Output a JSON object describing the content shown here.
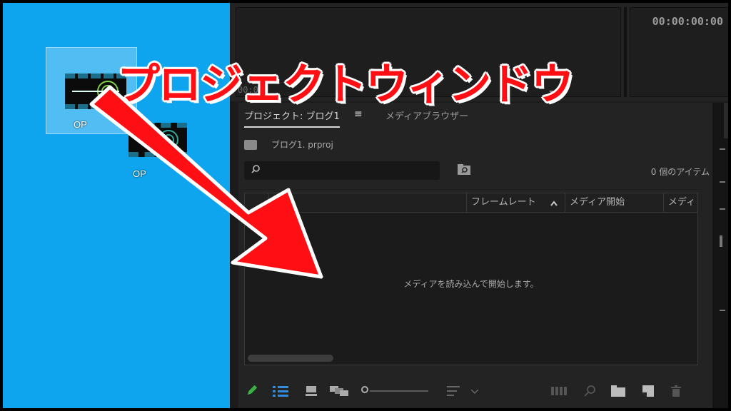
{
  "desktop": {
    "icons": [
      {
        "label": "OP",
        "selected": true
      },
      {
        "label": "OP"
      }
    ]
  },
  "monitor": {
    "timecode": "00:00:00:00",
    "mini_timecode": "00:0"
  },
  "project_panel": {
    "tabs": [
      {
        "label": "プロジェクト: ブログ1",
        "active": true
      },
      {
        "label": "メディアブラウザー",
        "active": false
      }
    ],
    "file_name": "ブログ1. prproj",
    "item_count": "0 個のアイテム",
    "columns": [
      "フレームレート",
      "メディア開始",
      "メディ"
    ],
    "empty_message": "メディアを読み込んで開始します。"
  },
  "annotation": {
    "banner_text": "プロジェクトウィンドウ",
    "arrow_color": "#ff0f14"
  },
  "colors": {
    "desktop_bg": "#0ea4ee",
    "panel_bg": "#232323",
    "icon_blue": "#2e8de0",
    "pen_green": "#3cb043"
  },
  "icons": {
    "new_item": "pencil-icon",
    "list_view": "list-view-icon",
    "icon_view": "icon-view-icon",
    "freeform_view": "freeform-view-icon",
    "sort": "sort-icon",
    "automate": "automate-to-sequence-icon",
    "find": "find-icon",
    "new_bin": "new-bin-icon",
    "new_item_btn": "new-item-icon",
    "clear": "trash-icon"
  }
}
